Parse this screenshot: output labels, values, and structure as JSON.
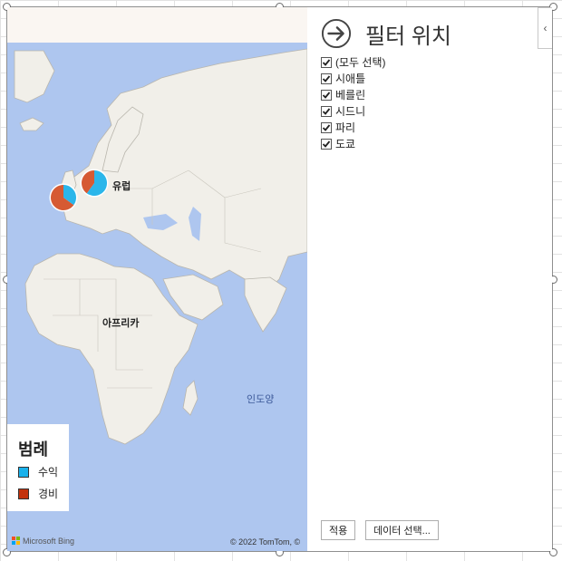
{
  "map": {
    "region_labels": {
      "europe": "유럽",
      "africa": "아프리카",
      "indian_ocean": "인도양"
    },
    "attribution": "© 2022 TomTom, ©",
    "bing_logo": "Microsoft Bing",
    "pie_markers": [
      {
        "name": "pie-marker-paris",
        "revenue_fraction": 0.35,
        "expense_fraction": 0.65
      },
      {
        "name": "pie-marker-berlin",
        "revenue_fraction": 0.6,
        "expense_fraction": 0.4
      }
    ]
  },
  "legend": {
    "title": "범례",
    "items": [
      {
        "label": "수익",
        "color": "#1ab2ec"
      },
      {
        "label": "경비",
        "color": "#c3320d"
      }
    ]
  },
  "filter": {
    "title": "필터 위치",
    "collapse_glyph": "‹",
    "items": [
      {
        "label": "(모두 선택)",
        "checked": true
      },
      {
        "label": "시애틀",
        "checked": true
      },
      {
        "label": "베를린",
        "checked": true
      },
      {
        "label": "시드니",
        "checked": true
      },
      {
        "label": "파리",
        "checked": true
      },
      {
        "label": "도쿄",
        "checked": true
      }
    ],
    "apply_button": "적용",
    "select_data_button": "데이터 선택..."
  },
  "colors": {
    "revenue": "#2bb6ea",
    "expense": "#d65a33",
    "ocean": "#aec6ef",
    "land": "#f1efe9"
  }
}
